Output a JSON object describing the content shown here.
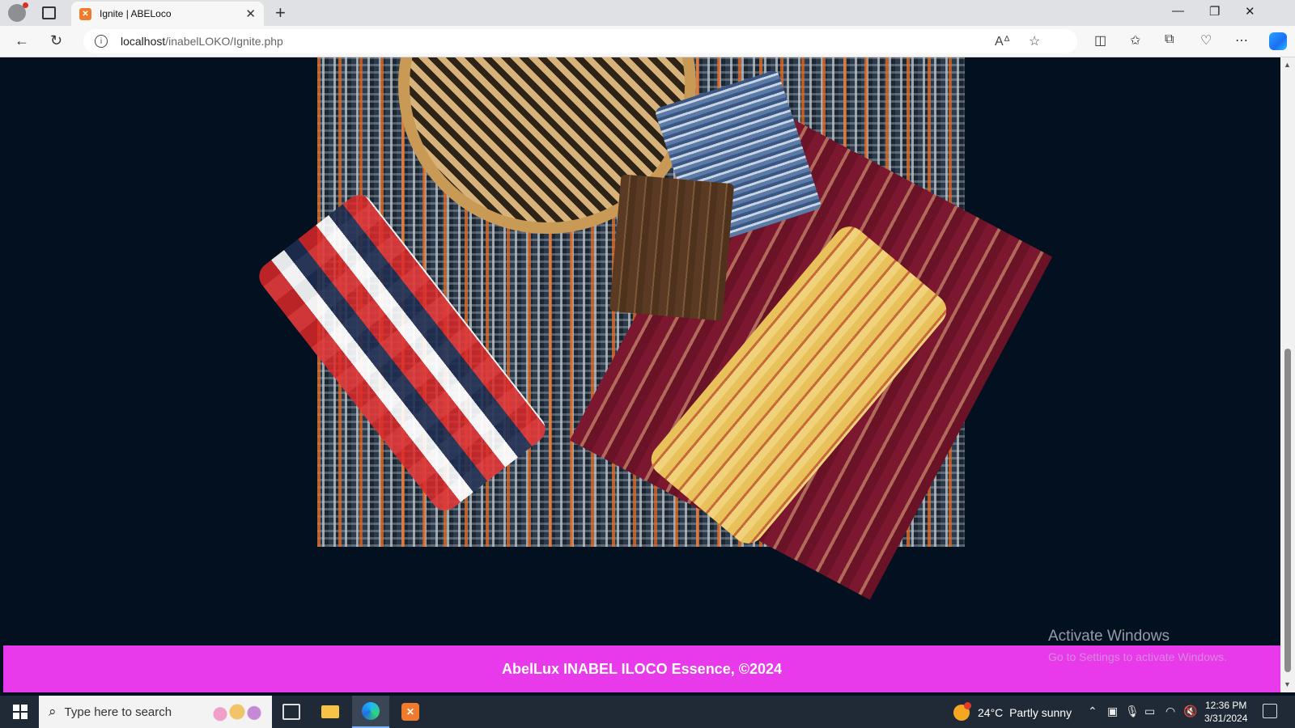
{
  "browser": {
    "tab_title": "Ignite | ABELoco",
    "tab_favicon": "xampp-icon",
    "url_host": "localhost",
    "url_path": "/inabelLOKO/Ignite.php",
    "new_tab": "+",
    "close_tab": "✕",
    "window_controls": {
      "minimize": "—",
      "restore": "❐",
      "close": "✕"
    }
  },
  "page": {
    "image": "woven-inabel-bags-photo",
    "footer_text": "AbelLux INABEL ILOCO Essence, ©2024",
    "footer_color": "#e83aea",
    "background_color": "#02101f"
  },
  "watermark": {
    "line1": "Activate Windows",
    "line2": "Go to Settings to activate Windows."
  },
  "taskbar": {
    "search_placeholder": "Type here to search",
    "weather_temp": "24°C",
    "weather_desc": "Partly sunny",
    "time": "12:36 PM",
    "date": "3/31/2024"
  }
}
